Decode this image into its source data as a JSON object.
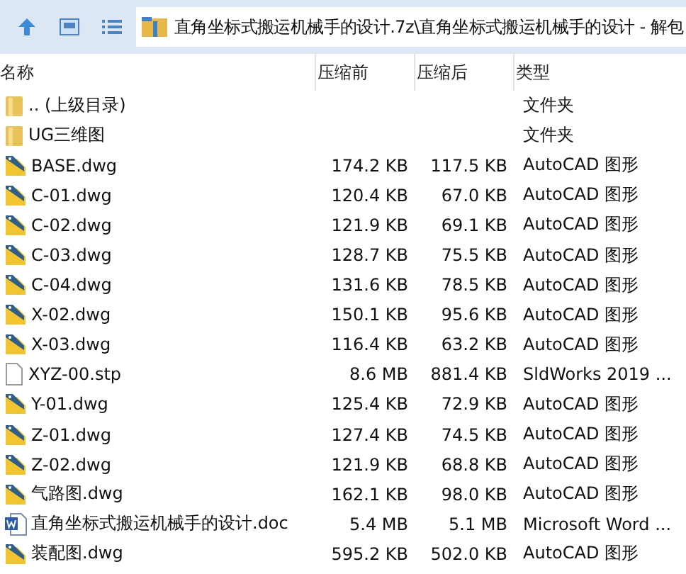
{
  "address": "直角坐标式搬运机械手的设计.7z\\直角坐标式搬运机械手的设计 - 解包",
  "columns": [
    "名称",
    "压缩前",
    "压缩后",
    "类型"
  ],
  "rows": [
    {
      "kind": "folder",
      "name": ".. (上级目录)",
      "type": "文件夹"
    },
    {
      "kind": "folder",
      "name": "UG三维图",
      "type": "文件夹"
    },
    {
      "kind": "dwg",
      "name": "BASE.dwg",
      "before": "174.2 KB",
      "after": "117.5 KB",
      "type": "AutoCAD 图形"
    },
    {
      "kind": "dwg",
      "name": "C-01.dwg",
      "before": "120.4 KB",
      "after": "67.0 KB",
      "type": "AutoCAD 图形"
    },
    {
      "kind": "dwg",
      "name": "C-02.dwg",
      "before": "121.9 KB",
      "after": "69.1 KB",
      "type": "AutoCAD 图形"
    },
    {
      "kind": "dwg",
      "name": "C-03.dwg",
      "before": "128.7 KB",
      "after": "75.5 KB",
      "type": "AutoCAD 图形"
    },
    {
      "kind": "dwg",
      "name": "C-04.dwg",
      "before": "131.6 KB",
      "after": "78.5 KB",
      "type": "AutoCAD 图形"
    },
    {
      "kind": "dwg",
      "name": "X-02.dwg",
      "before": "150.1 KB",
      "after": "95.6 KB",
      "type": "AutoCAD 图形"
    },
    {
      "kind": "dwg",
      "name": "X-03.dwg",
      "before": "116.4 KB",
      "after": "63.2 KB",
      "type": "AutoCAD 图形"
    },
    {
      "kind": "file",
      "name": "XYZ-00.stp",
      "before": "8.6 MB",
      "after": "881.4 KB",
      "type": "SldWorks 2019 ..."
    },
    {
      "kind": "dwg",
      "name": "Y-01.dwg",
      "before": "125.4 KB",
      "after": "72.9 KB",
      "type": "AutoCAD 图形"
    },
    {
      "kind": "dwg",
      "name": "Z-01.dwg",
      "before": "127.4 KB",
      "after": "74.5 KB",
      "type": "AutoCAD 图形"
    },
    {
      "kind": "dwg",
      "name": "Z-02.dwg",
      "before": "121.9 KB",
      "after": "68.8 KB",
      "type": "AutoCAD 图形"
    },
    {
      "kind": "dwg",
      "name": "气路图.dwg",
      "before": "162.1 KB",
      "after": "98.0 KB",
      "type": "AutoCAD 图形"
    },
    {
      "kind": "word",
      "name": "直角坐标式搬运机械手的设计.doc",
      "before": "5.4 MB",
      "after": "5.1 MB",
      "type": "Microsoft Word ..."
    },
    {
      "kind": "dwg",
      "name": "装配图.dwg",
      "before": "595.2 KB",
      "after": "502.0 KB",
      "type": "AutoCAD 图形"
    }
  ]
}
